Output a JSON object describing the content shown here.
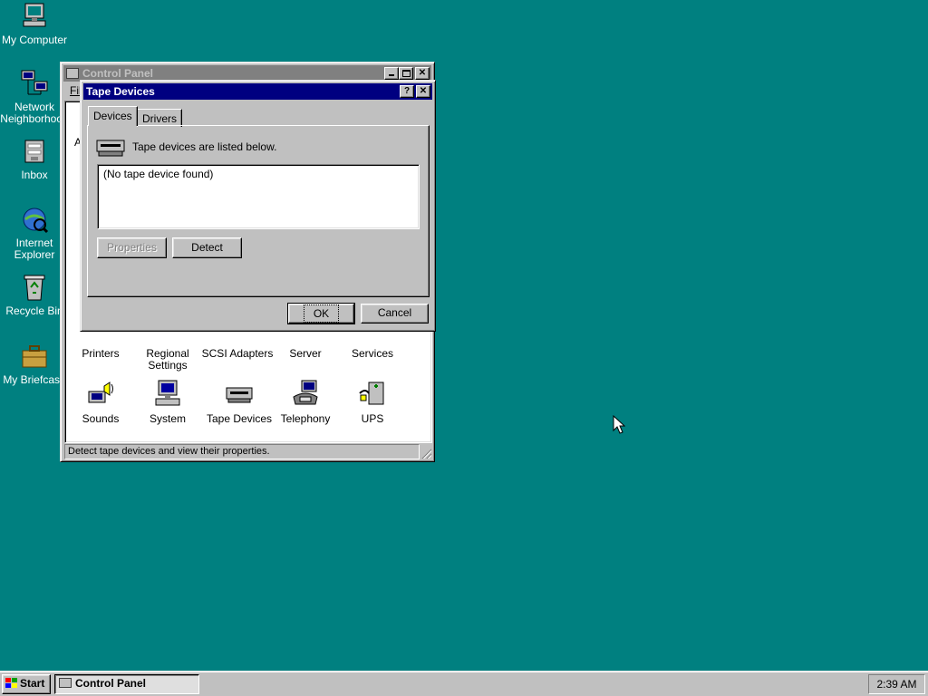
{
  "desktop": {
    "icons": [
      {
        "label": "My Computer",
        "icon": "my-computer-icon"
      },
      {
        "label": "Network Neighborhood",
        "icon": "network-icon"
      },
      {
        "label": "Inbox",
        "icon": "inbox-icon"
      },
      {
        "label": "Internet Explorer",
        "icon": "internet-explorer-icon"
      },
      {
        "label": "Recycle Bin",
        "icon": "recycle-bin-icon"
      },
      {
        "label": "My Briefcase",
        "icon": "briefcase-icon"
      }
    ]
  },
  "control_panel": {
    "title": "Control Panel",
    "menu_partial": "Fil",
    "partial_letter": "A",
    "items_row1": [
      {
        "label": "Printers",
        "icon": "printer-icon"
      },
      {
        "label": "Regional Settings",
        "icon": "globe-icon"
      },
      {
        "label": "SCSI Adapters",
        "icon": "scsi-icon"
      },
      {
        "label": "Server",
        "icon": "server-icon"
      },
      {
        "label": "Services",
        "icon": "services-icon"
      }
    ],
    "items_row2": [
      {
        "label": "Sounds",
        "icon": "speaker-icon"
      },
      {
        "label": "System",
        "icon": "computer-icon"
      },
      {
        "label": "Tape Devices",
        "icon": "tape-drive-icon"
      },
      {
        "label": "Telephony",
        "icon": "telephone-icon"
      },
      {
        "label": "UPS",
        "icon": "ups-icon"
      }
    ],
    "status_text": "Detect tape devices and view their properties."
  },
  "dialog": {
    "title": "Tape Devices",
    "help_glyph": "?",
    "close_glyph": "✕",
    "tabs": [
      "Devices",
      "Drivers"
    ],
    "info_text": "Tape devices are listed below.",
    "list_items": [
      "(No tape device found)"
    ],
    "properties_label": "Properties",
    "detect_label": "Detect",
    "ok_label": "OK",
    "cancel_label": "Cancel"
  },
  "taskbar": {
    "start_label": "Start",
    "task_label": "Control Panel",
    "clock": "2:39 AM"
  }
}
